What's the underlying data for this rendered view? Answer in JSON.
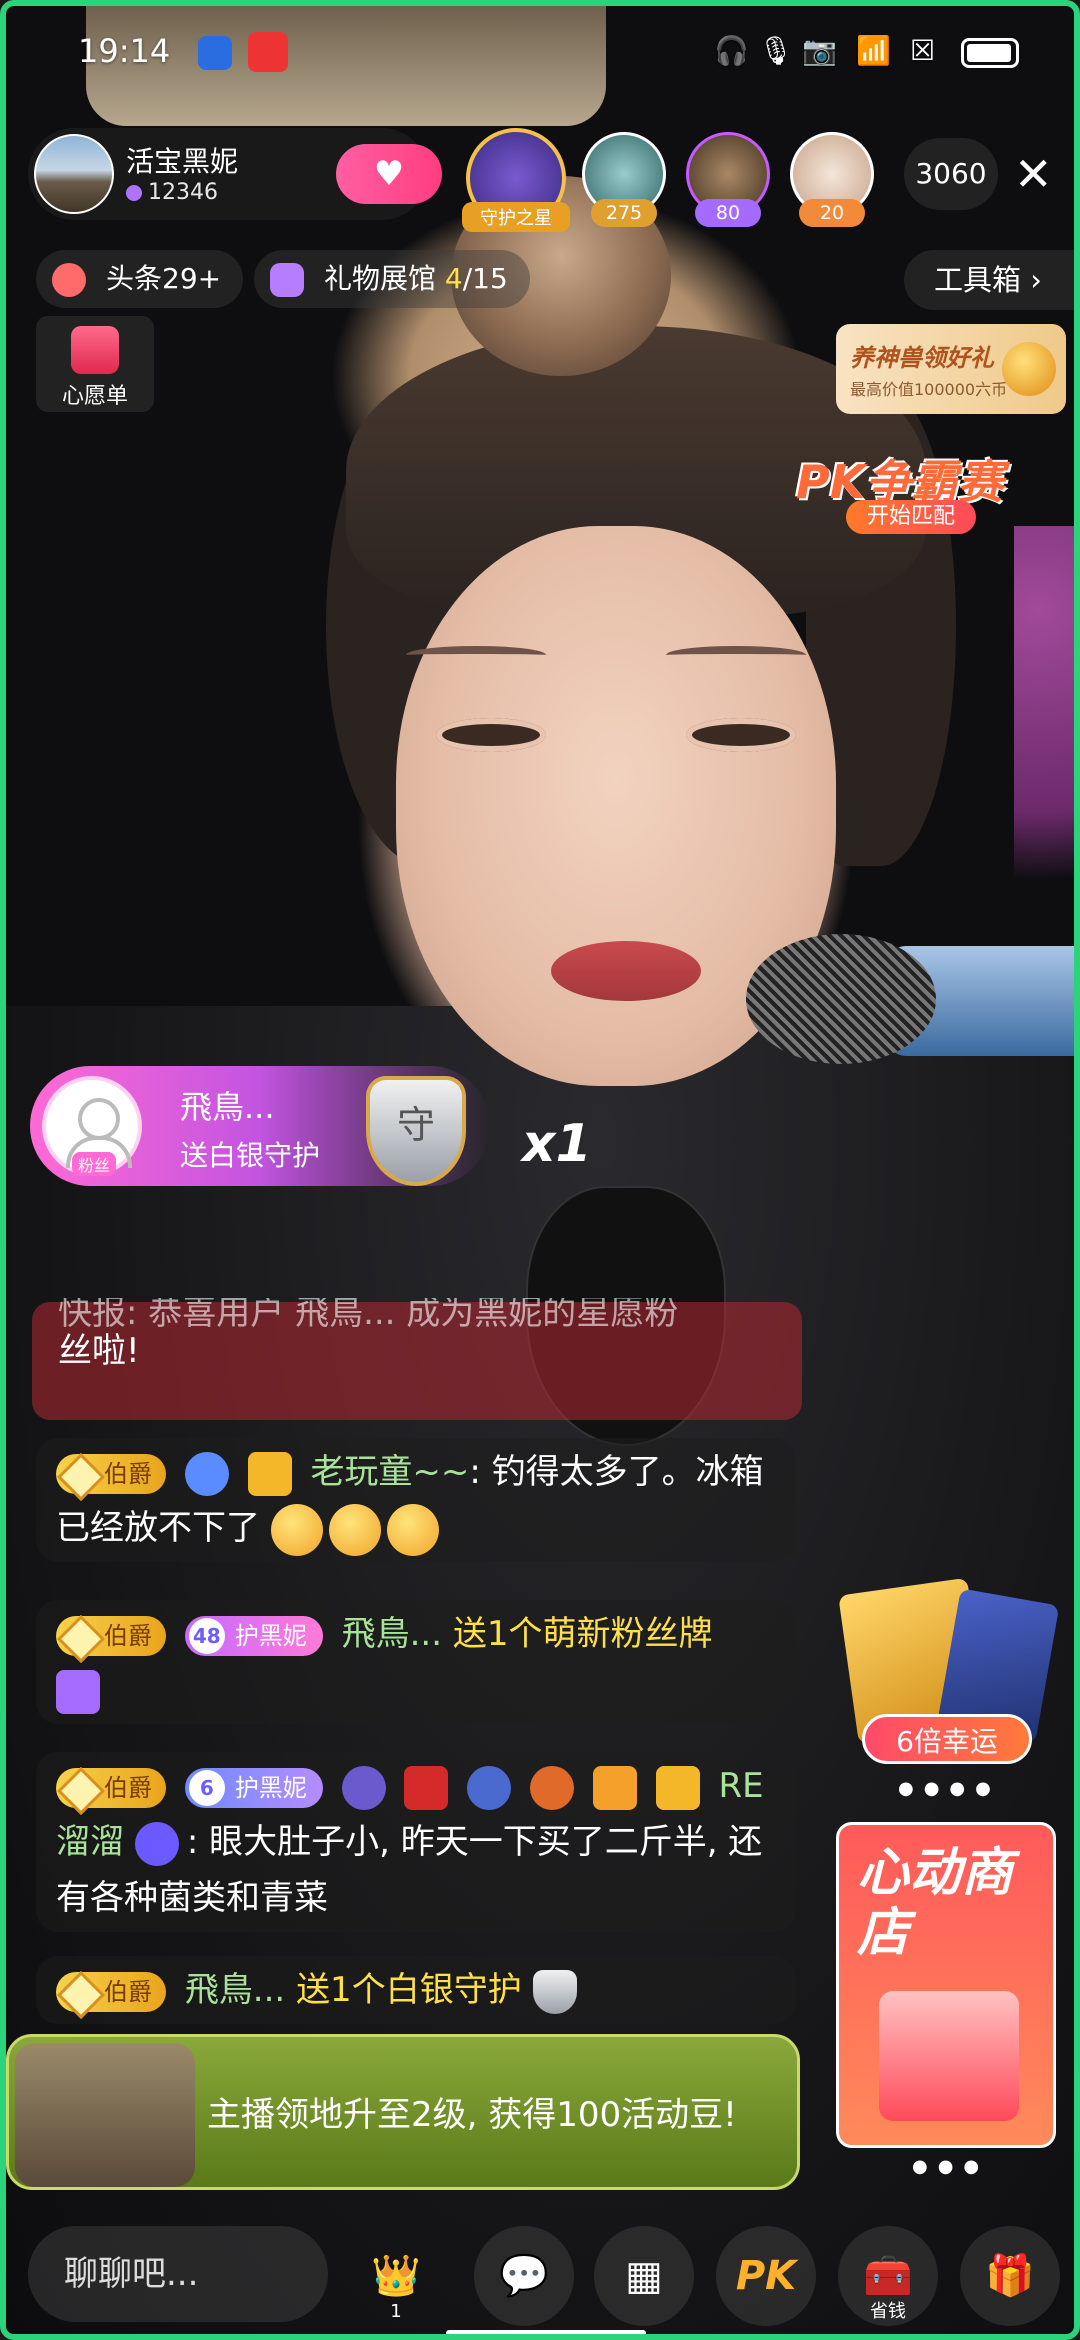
{
  "status_bar": {
    "time": "19:14"
  },
  "host": {
    "name": "活宝黑妮",
    "id": "12346"
  },
  "guard_badge": {
    "label": "守护之星"
  },
  "top_viewers": [
    {
      "badge": "275"
    },
    {
      "badge": "80"
    },
    {
      "badge": "20"
    }
  ],
  "viewer_count": "3060",
  "chips": {
    "headlines": "头条29+",
    "gallery_label": "礼物展馆",
    "gallery_current": "4",
    "gallery_total": "/15",
    "toolbox": "工具箱"
  },
  "wishlist": {
    "label": "心愿单"
  },
  "promo": {
    "title": "养神兽领好礼",
    "subtitle": "最高价值100000六币"
  },
  "pk": {
    "title": "PK争霸赛",
    "action": "开始匹配"
  },
  "gift_banner": {
    "user": "飛鳥...",
    "desc": "送白银守护",
    "tag": "粉丝",
    "shield": "守",
    "count": "x1"
  },
  "chat": {
    "system": "快报: 恭喜用户 飛鳥... 成为黑妮的星愿粉",
    "system2": "丝啦!",
    "messages": [
      {
        "level": "伯爵",
        "user": "老玩童~~",
        "text": ": 钓得太多了。冰箱已经放不下了"
      },
      {
        "level": "伯爵",
        "badge_num": "48",
        "badge": "护黑妮",
        "user": "飛鳥...",
        "text": "送1个萌新粉丝牌"
      },
      {
        "level": "伯爵",
        "badge_num": "6",
        "badge": "护黑妮",
        "user": "RE溜溜",
        "text": ": 眼大肚子小, 昨天一下买了二斤半, 还有各种菌类和青菜"
      },
      {
        "level": "伯爵",
        "user": "飛鳥...",
        "text": "送1个白银守护"
      }
    ]
  },
  "lucky": {
    "label": "6倍幸运"
  },
  "store": {
    "title": "心动商店"
  },
  "notice": {
    "text": "主播领地升至2级, 获得100活动豆!"
  },
  "bottom": {
    "placeholder": "聊聊吧...",
    "seat_badge": "1",
    "chest_label": "省钱",
    "pk_label": "PK"
  }
}
